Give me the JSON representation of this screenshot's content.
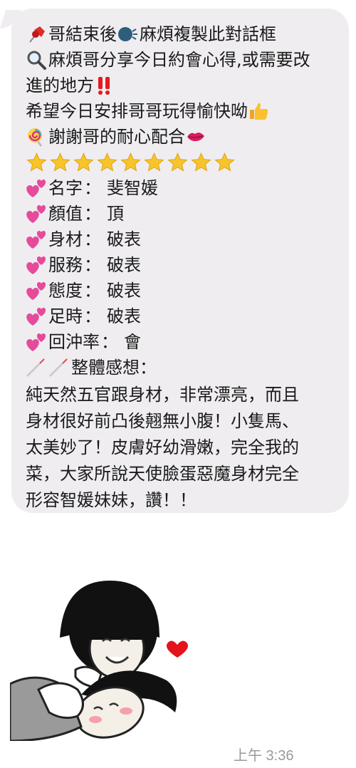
{
  "message": {
    "lines": [
      {
        "icon": "pushpin-icon",
        "text": "哥結束後"
      },
      {
        "icon": "search-icon",
        "text": "麻煩哥分享今日約會心得,或需要改"
      },
      {
        "icon": "",
        "text": "進的地方"
      },
      {
        "icon": "",
        "text": "希望今日安排哥哥玩得愉快呦"
      },
      {
        "icon": "lollipop-icon",
        "text": "謝謝哥的耐心配合"
      }
    ],
    "line1_suffix": "麻煩複製此對話框",
    "star_count": 9,
    "fields": [
      {
        "label": "名字",
        "value": "斐智媛"
      },
      {
        "label": "顏值",
        "value": "頂"
      },
      {
        "label": "身材",
        "value": "破表"
      },
      {
        "label": "服務",
        "value": "破表"
      },
      {
        "label": "態度",
        "value": "破表"
      },
      {
        "label": "足時",
        "value": "破表"
      },
      {
        "label": "回沖率",
        "value": "會"
      }
    ],
    "field_separator": "：",
    "summary_label": "整體感想：",
    "summary_lines": [
      "純天然五官跟身材，非常漂亮，而且",
      "身材很好前凸後翹無小腹！小隻馬、",
      "太美妙了！皮膚好幼滑嫩，完全我的",
      "菜，大家所說天使臉蛋惡魔身材完全",
      "形容智媛妹妹，讚！！"
    ]
  },
  "timestamp": "上午 3:36",
  "colors": {
    "bubble": "#efedf0",
    "star": "#f7c52b",
    "heart": "#e64a9a",
    "timestamp": "#9a9a9a"
  }
}
